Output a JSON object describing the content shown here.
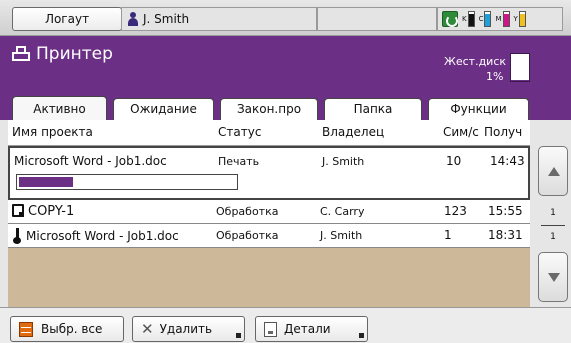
{
  "topbar": {
    "logout_label": "Логаут",
    "user_name": "J. Smith",
    "inks": [
      {
        "letter": "K",
        "color": "#111111",
        "level": 0.85
      },
      {
        "letter": "C",
        "color": "#1fa0d8",
        "level": 0.85
      },
      {
        "letter": "M",
        "color": "#d0178a",
        "level": 0.85
      },
      {
        "letter": "Y",
        "color": "#f0c020",
        "level": 0.85
      }
    ]
  },
  "header": {
    "title": "Принтер",
    "disk_label": "Жест.диск",
    "disk_percent": "1%",
    "disk_level": 0.01,
    "accent": "#6c2f86"
  },
  "tabs": [
    {
      "label": "Активно",
      "active": true
    },
    {
      "label": "Ожидание",
      "active": false
    },
    {
      "label": "Закон.про",
      "active": false
    },
    {
      "label": "Папка",
      "active": false
    },
    {
      "label": "Функции",
      "active": false
    }
  ],
  "table": {
    "columns": [
      "Имя проекта",
      "Статус",
      "Владелец",
      "Сим/с",
      "Получ"
    ],
    "rows": [
      {
        "name": "Microsoft Word - Job1.doc",
        "icon": "none",
        "status": "Печать",
        "owner": "J. Smith",
        "count": "10",
        "time": "14:43",
        "progress": 0.25
      },
      {
        "name": "COPY-1",
        "icon": "copy-icon",
        "status": "Обработка",
        "owner": "C. Carry",
        "count": "123",
        "time": "15:55"
      },
      {
        "name": "Microsoft Word - Job1.doc",
        "icon": "thermometer-icon",
        "status": "Обработка",
        "owner": "J. Smith",
        "count": "1",
        "time": "18:31"
      }
    ]
  },
  "pager": {
    "current": "1",
    "total": "1"
  },
  "bottom": {
    "select_all_label": "Выбр. все",
    "delete_label": "Удалить",
    "details_label": "Детали"
  }
}
